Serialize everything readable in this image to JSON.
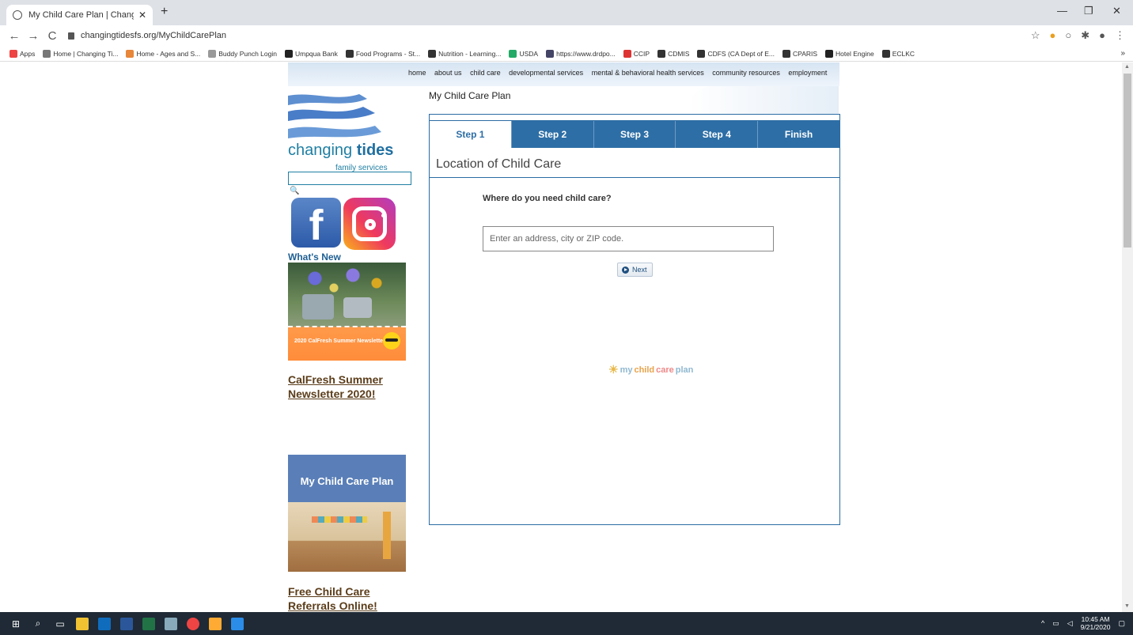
{
  "browser": {
    "tab_title": "My Child Care Plan | Changing Ti",
    "url": "changingtidesfs.org/MyChildCarePlan",
    "bookmarks": [
      {
        "label": "Apps",
        "color": "#e44"
      },
      {
        "label": "Home | Changing Ti...",
        "color": "#777"
      },
      {
        "label": "Home - Ages and S...",
        "color": "#e8863a"
      },
      {
        "label": "Buddy Punch Login",
        "color": "#999"
      },
      {
        "label": "Umpqua Bank",
        "color": "#222"
      },
      {
        "label": "Food Programs - St...",
        "color": "#333"
      },
      {
        "label": "Nutrition - Learning...",
        "color": "#333"
      },
      {
        "label": "USDA",
        "color": "#2a6"
      },
      {
        "label": "https://www.drdpo...",
        "color": "#446"
      },
      {
        "label": "CCIP",
        "color": "#d33"
      },
      {
        "label": "CDMIS",
        "color": "#333"
      },
      {
        "label": "CDFS (CA Dept of E...",
        "color": "#333"
      },
      {
        "label": "CPARIS",
        "color": "#333"
      },
      {
        "label": "Hotel Engine",
        "color": "#222"
      },
      {
        "label": "ECLKC",
        "color": "#333"
      }
    ],
    "more": "»"
  },
  "site": {
    "nav_items": [
      "home",
      "about us",
      "child care",
      "developmental services",
      "mental & behavioral health services",
      "community resources",
      "employment"
    ],
    "page_title": "My Child Care Plan",
    "brand_main": "changing",
    "brand_bold": "tides",
    "brand_sub": "family services",
    "whats_new": "What's New",
    "news_caption": "2020 CalFresh Summer Newsletter",
    "link_calfresh": "CalFresh Summer Newsletter 2020!",
    "mcp_banner_title": "My Child Care Plan",
    "link_free": "Free Child Care Referrals Online!"
  },
  "wizard": {
    "steps": [
      "Step 1",
      "Step 2",
      "Step 3",
      "Step 4",
      "Finish"
    ],
    "section_title": "Location of Child Care",
    "question": "Where do you need child care?",
    "address_placeholder": "Enter an address, city or ZIP code.",
    "next_label": "Next",
    "logo_my": "my",
    "logo_child": "child",
    "logo_care": "care",
    "logo_plan": "plan"
  },
  "taskbar": {
    "time": "10:45 AM",
    "date": "9/21/2020"
  }
}
